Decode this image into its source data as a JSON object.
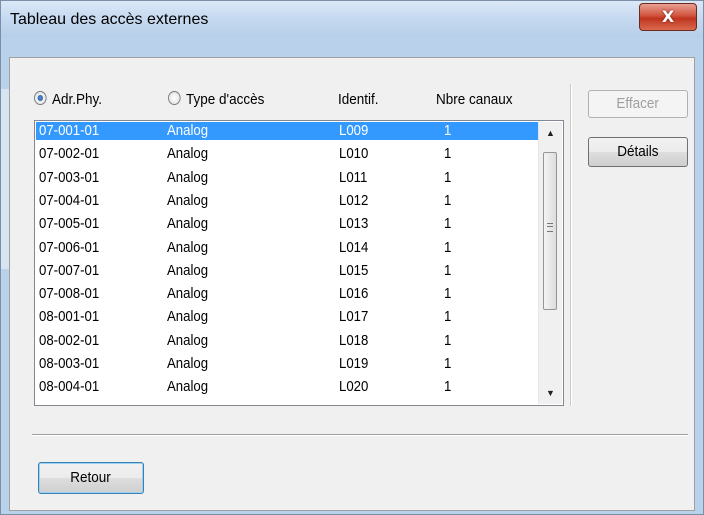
{
  "window": {
    "title": "Tableau des accès externes",
    "close_label": "X"
  },
  "columns": {
    "adr_phy": "Adr.Phy.",
    "type_acces": "Type d'accès",
    "identif": "Identif.",
    "nbre_canaux": "Nbre canaux"
  },
  "sort_selection": "adr_phy",
  "rows": [
    {
      "adr": "07-001-01",
      "type": "Analog",
      "id": "L009",
      "canaux": "1",
      "selected": true
    },
    {
      "adr": "07-002-01",
      "type": "Analog",
      "id": "L010",
      "canaux": "1"
    },
    {
      "adr": "07-003-01",
      "type": "Analog",
      "id": "L011",
      "canaux": "1"
    },
    {
      "adr": "07-004-01",
      "type": "Analog",
      "id": "L012",
      "canaux": "1"
    },
    {
      "adr": "07-005-01",
      "type": "Analog",
      "id": "L013",
      "canaux": "1"
    },
    {
      "adr": "07-006-01",
      "type": "Analog",
      "id": "L014",
      "canaux": "1"
    },
    {
      "adr": "07-007-01",
      "type": "Analog",
      "id": "L015",
      "canaux": "1"
    },
    {
      "adr": "07-008-01",
      "type": "Analog",
      "id": "L016",
      "canaux": "1"
    },
    {
      "adr": "08-001-01",
      "type": "Analog",
      "id": "L017",
      "canaux": "1"
    },
    {
      "adr": "08-002-01",
      "type": "Analog",
      "id": "L018",
      "canaux": "1"
    },
    {
      "adr": "08-003-01",
      "type": "Analog",
      "id": "L019",
      "canaux": "1"
    },
    {
      "adr": "08-004-01",
      "type": "Analog",
      "id": "L020",
      "canaux": "1"
    }
  ],
  "buttons": {
    "effacer": "Effacer",
    "details": "Détails",
    "retour": "Retour"
  },
  "icons": {
    "close": "close-icon",
    "scroll_up": "scroll-up-arrow-icon",
    "scroll_down": "scroll-down-arrow-icon",
    "grip": "scrollbar-grip-icon"
  },
  "colors": {
    "selection": "#3399ff",
    "titlebar": "#c5d9f0",
    "close_button": "#c8432a"
  }
}
